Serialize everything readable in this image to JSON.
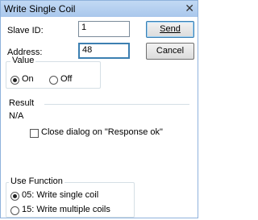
{
  "window": {
    "title": "Write Single Coil"
  },
  "form": {
    "slave_id_label": "Slave ID:",
    "slave_id_value": "1",
    "address_label": "Address:",
    "address_value": "48"
  },
  "buttons": {
    "send": "Send",
    "cancel": "Cancel"
  },
  "value_group": {
    "title": "Value",
    "options": [
      {
        "label": "On",
        "checked": true
      },
      {
        "label": "Off",
        "checked": false
      }
    ]
  },
  "result": {
    "title": "Result",
    "text": "N/A"
  },
  "close_dialog_checkbox": {
    "label": "Close dialog on \"Response ok\"",
    "checked": false
  },
  "use_function": {
    "title": "Use Function",
    "options": [
      {
        "label": "05: Write single coil",
        "checked": true
      },
      {
        "label": "15: Write multiple coils",
        "checked": false
      }
    ]
  }
}
